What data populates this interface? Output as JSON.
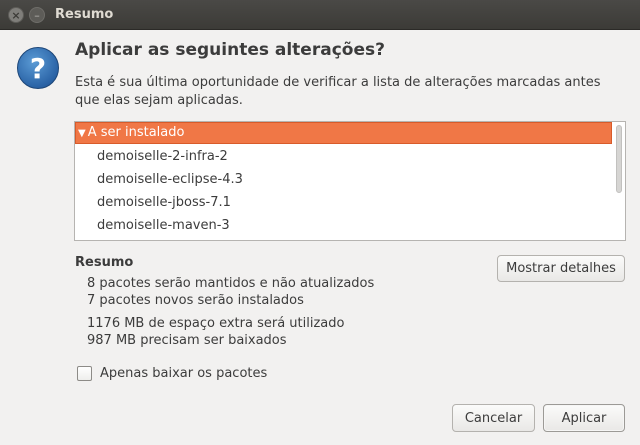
{
  "window": {
    "title": "Resumo",
    "close_glyph": "×",
    "minimize_glyph": "–"
  },
  "icon": {
    "name": "question-icon",
    "glyph": "?"
  },
  "dialog": {
    "heading": "Aplicar as seguintes alterações?",
    "description": "Esta é sua última oportunidade de verificar a lista de alterações marcadas antes que elas sejam aplicadas."
  },
  "change_list": {
    "group_label": "A ser instalado",
    "packages": [
      "demoiselle-2-infra-2",
      "demoiselle-eclipse-4.3",
      "demoiselle-jboss-7.1",
      "demoiselle-maven-3"
    ]
  },
  "summary": {
    "title": "Resumo",
    "lines": [
      "8 pacotes serão mantidos e não atualizados",
      "7 pacotes novos serão instalados",
      "1176 MB de espaço extra será utilizado",
      "987 MB precisam ser baixados"
    ],
    "details_button": "Mostrar detalhes"
  },
  "options": {
    "download_only_label": "Apenas baixar os pacotes",
    "download_only_checked": false
  },
  "buttons": {
    "cancel": "Cancelar",
    "apply": "Aplicar"
  },
  "colors": {
    "selection": "#f07746",
    "titlebar": "#3c3b37"
  }
}
